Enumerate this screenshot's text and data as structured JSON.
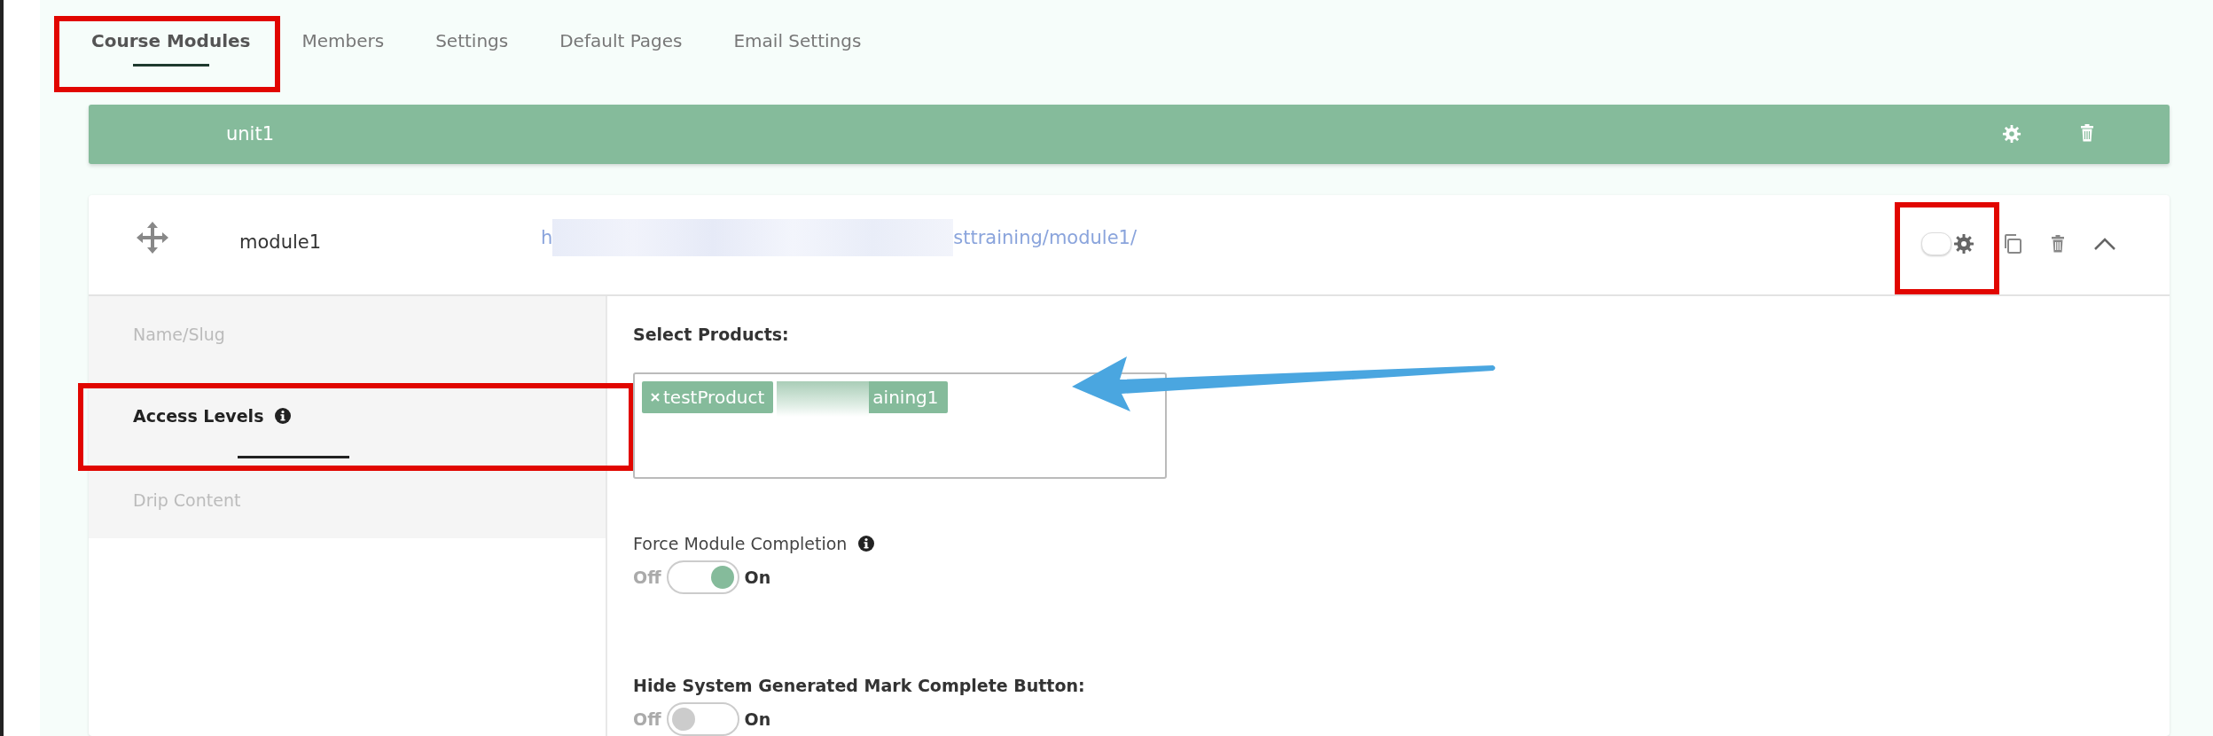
{
  "tabs": [
    {
      "label": "Course Modules",
      "selected": true,
      "highlighted": true
    },
    {
      "label": "Members",
      "selected": false
    },
    {
      "label": "Settings",
      "selected": false
    },
    {
      "label": "Default Pages",
      "selected": false
    },
    {
      "label": "Email Settings",
      "selected": false
    }
  ],
  "unit": {
    "title": "unit1"
  },
  "module": {
    "title": "module1",
    "url_start": "h",
    "url_end": "sttraining/module1/",
    "url_redacted": true,
    "enabled": false,
    "toggle_highlighted": true,
    "expanded": true
  },
  "side_nav": [
    {
      "label": "Name/Slug",
      "selected": false
    },
    {
      "label": "Access Levels",
      "selected": true,
      "info": true,
      "highlighted": true
    },
    {
      "label": "Drip Content",
      "selected": false
    }
  ],
  "form": {
    "products_label": "Select Products:",
    "pointer_arrow": true,
    "products": [
      {
        "label": "testProduct",
        "removable": true
      },
      {
        "label": "aining1",
        "redacted": true
      }
    ],
    "fields": [
      {
        "label": "Force Module Completion",
        "bold": false,
        "info": true,
        "off_label": "Off",
        "on_label": "On",
        "on": true
      },
      {
        "label": "Hide System Generated Mark Complete Button:",
        "bold": true,
        "off_label": "Off",
        "on_label": "On",
        "on": false
      }
    ]
  }
}
